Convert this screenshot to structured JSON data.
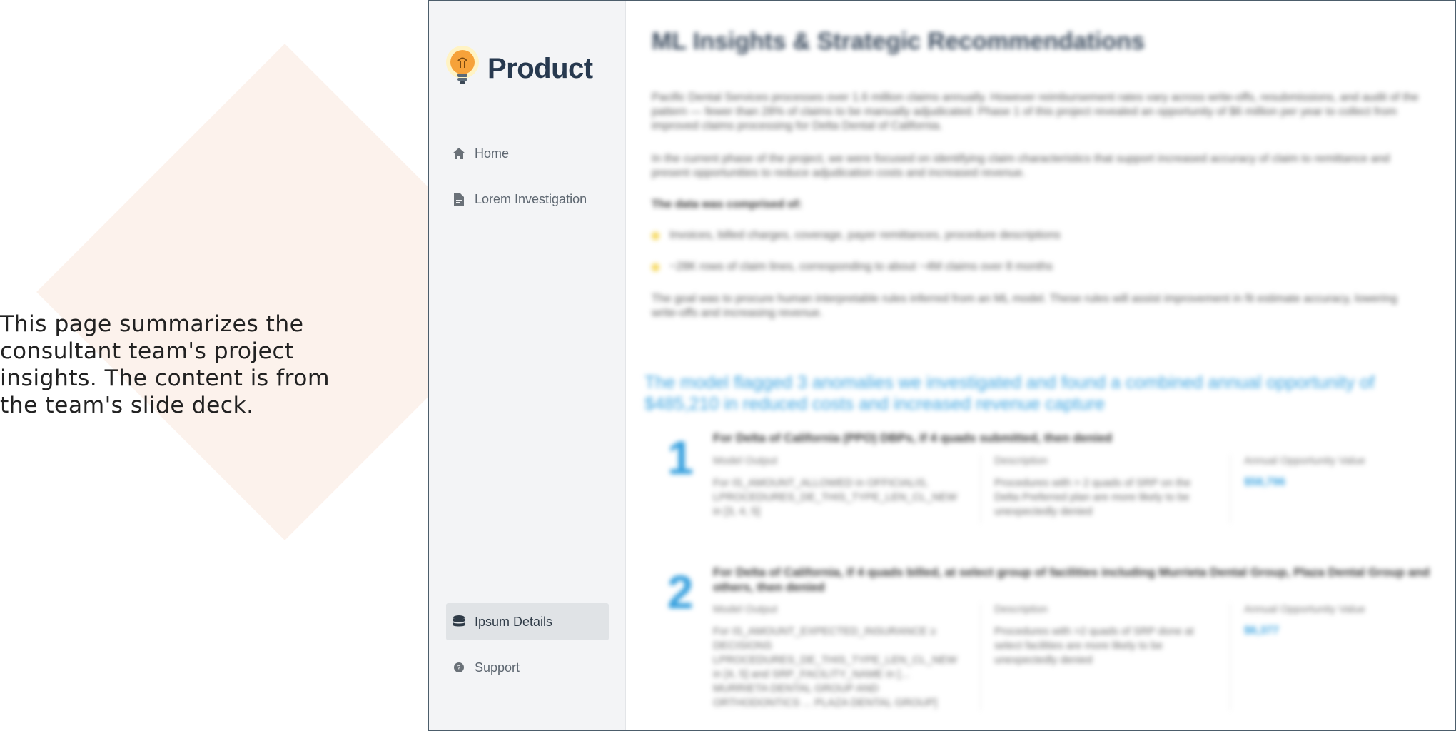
{
  "caption": "This page summarizes the consultant team's project insights. The content is from the team's slide deck.",
  "brand": {
    "title": "Product",
    "icon": "lightbulb-icon"
  },
  "nav": {
    "home": {
      "label": "Home",
      "icon": "home-icon"
    },
    "lorem": {
      "label": "Lorem Investigation",
      "icon": "document-icon"
    },
    "ipsum": {
      "label": "Ipsum Details",
      "icon": "database-icon",
      "active": true
    },
    "support": {
      "label": "Support",
      "icon": "question-icon"
    }
  },
  "main": {
    "title": "ML Insights & Strategic Recommendations",
    "para1": "Pacific Dental Services processes over 1.6 million claims annually. However reimbursement rates vary across write-offs, resubmissions, and audit of the pattern — fewer than 28% of claims to be manually adjudicated. Phase 1 of this project revealed an opportunity of $6 million per year to collect from improved claims processing for Delta Dental of California.",
    "para2": "In the current phase of the project, we were focused on identifying claim characteristics that support increased accuracy of claim to remittance and present opportunities to reduce adjudication costs and increased revenue.",
    "data_heading": "The data was comprised of:",
    "bullet1": "Invoices, billed charges, coverage, payer remittances, procedure descriptions",
    "bullet2": "~28K rows of claim lines, corresponding to about ~4M claims over 8 months",
    "para3": "The goal was to procure human interpretable rules inferred from an ML model. These rules will assist improvement in fit estimate accuracy, lowering write-offs and increasing revenue.",
    "highlight": "The model flagged 3 anomalies we investigated and found a combined annual opportunity of $485,210 in reduced costs and increased revenue capture",
    "col_model": "Model Output",
    "col_desc": "Description",
    "col_value": "Annual Opportunity Value",
    "insights": [
      {
        "number": "1",
        "title": "For Delta of California (PPO) DBPs, if 4 quads submitted, then denied",
        "model_output": "For IS_AMOUNT_ALLOWED in OFFICIALIS, LPROCEDURES_DE_THIS_TYPE_LEN_CL_NEW in [3, 4, 5]",
        "description": "Procedures with > 2 quads of SRP on the Delta Preferred plan are more likely to be unexpectedly denied",
        "value": "$58,796"
      },
      {
        "number": "2",
        "title": "For Delta of California, if 4 quads billed, at select group of facilities including Murrieta Dental Group, Plaza Dental Group and others, then denied",
        "model_output": "For IS_AMOUNT_EXPECTED_INSURANCE ≥ DECISIONS LPROCEDURES_DE_THIS_TYPE_LEN_CL_NEW in [4, 5] and SRP_FACILITY_NAME in [... MURRIETA DENTAL GROUP AND ORTHODONTICS ... PLAZA DENTAL GROUP]",
        "description": "Procedures with >2 quads of SRP done at select facilities are more likely to be unexpectedly denied",
        "value": "$6,377"
      }
    ]
  }
}
